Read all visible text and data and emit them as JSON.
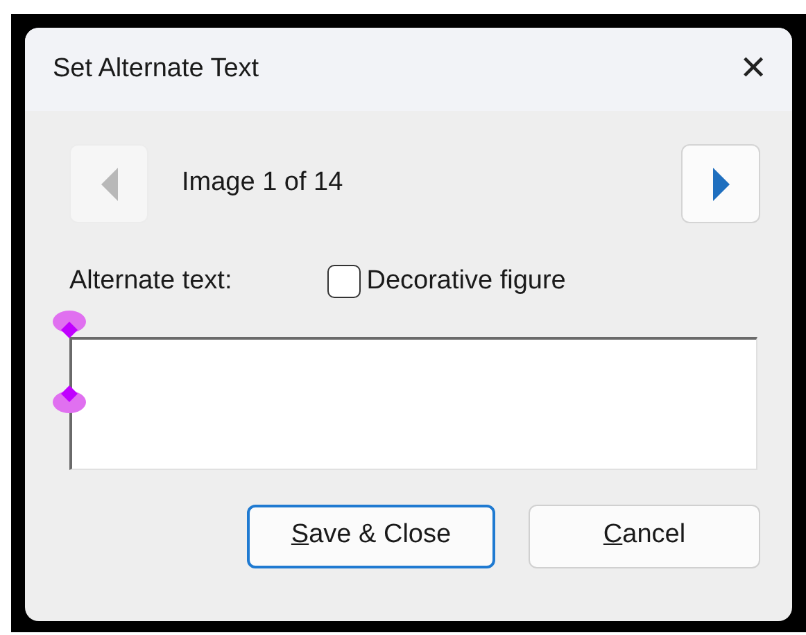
{
  "window": {
    "title": "Set Alternate Text",
    "close_glyph": "✕"
  },
  "navigator": {
    "previous": {
      "disabled": true
    },
    "position": "Image 1 of 14",
    "next": {
      "disabled": false
    }
  },
  "alt_text": {
    "label": "Alternate text:",
    "selection_handles": true
  },
  "decorative": {
    "label": "Decorative figure",
    "checked": false
  },
  "buttons": [
    {
      "label": "Save & Close",
      "default": true,
      "underline_first": true
    },
    {
      "label": "Cancel",
      "default": false,
      "underline_first": true
    }
  ]
}
